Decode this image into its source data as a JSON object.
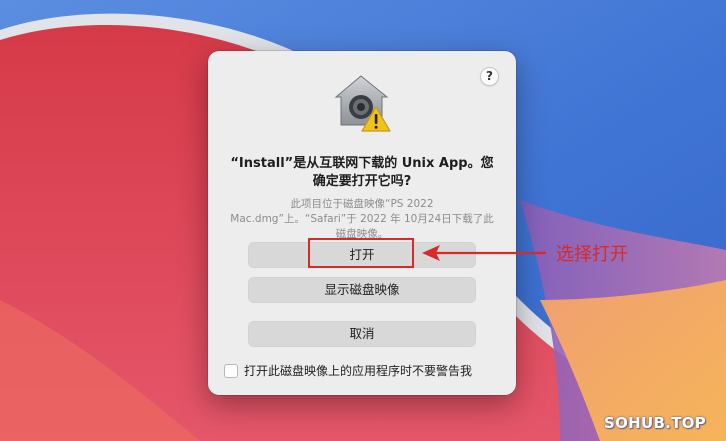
{
  "dialog": {
    "title": "“Install”是从互联网下载的 Unix App。您确定要打开它吗?",
    "info": "此项目位于磁盘映像“PS 2022 Mac.dmg”上。“Safari”于 2022 年 10月24日下载了此磁盘映像。",
    "help_label": "?",
    "app_icon": "gatekeeper-warning-icon",
    "buttons": {
      "open": "打开",
      "show_disk_image": "显示磁盘映像",
      "cancel": "取消"
    },
    "checkbox": {
      "label": "打开此磁盘映像上的应用程序时不要警告我",
      "checked": false
    }
  },
  "annotation": {
    "text": "选择打开",
    "color": "#d92929"
  },
  "watermark": "SOHUB.TOP"
}
